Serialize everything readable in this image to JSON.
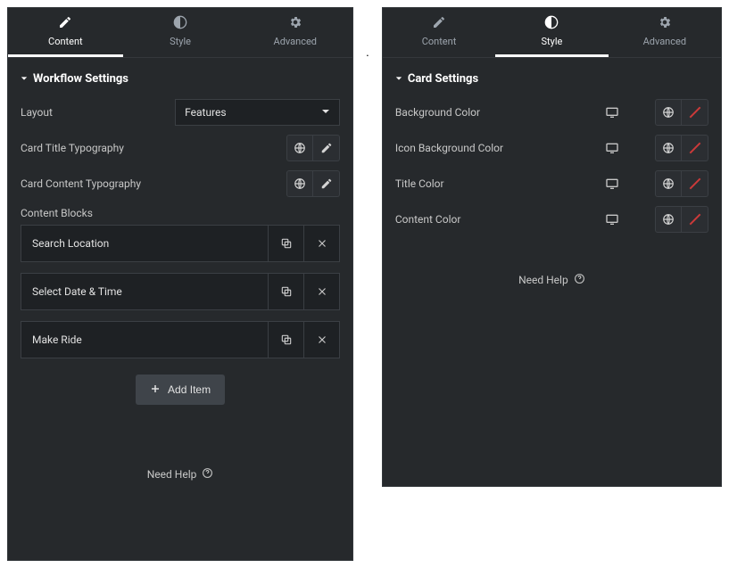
{
  "tabs": {
    "content": "Content",
    "style": "Style",
    "advanced": "Advanced"
  },
  "left": {
    "section_title": "Workflow Settings",
    "layout_label": "Layout",
    "layout_value": "Features",
    "card_title_typography": "Card Title Typography",
    "card_content_typography": "Card Content Typography",
    "content_blocks_label": "Content Blocks",
    "items": [
      {
        "title": "Search Location"
      },
      {
        "title": "Select Date & Time"
      },
      {
        "title": "Make Ride"
      }
    ],
    "add_item": "Add Item",
    "need_help": "Need Help"
  },
  "right": {
    "section_title": "Card Settings",
    "rows": [
      {
        "label": "Background Color"
      },
      {
        "label": "Icon Background Color"
      },
      {
        "label": "Title Color"
      },
      {
        "label": "Content Color"
      }
    ],
    "need_help": "Need Help"
  }
}
